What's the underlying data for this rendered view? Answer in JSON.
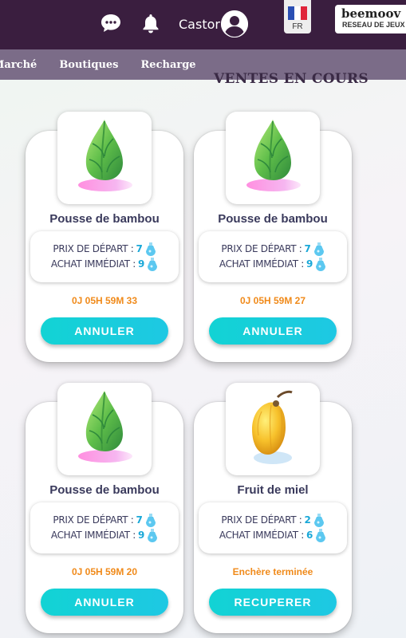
{
  "header": {
    "username": "Castor",
    "language": "FR",
    "brand_name": "beemoov",
    "brand_sub": "RESEAU DE JEUX",
    "icons": [
      "chat-icon",
      "bell-icon",
      "user-avatar-icon",
      "french-flag-icon"
    ]
  },
  "nav": {
    "items": [
      "Marché",
      "Boutiques",
      "Recharge"
    ]
  },
  "section_title": "VENTES EN COURS",
  "colors": {
    "topbar": "#3a1e3f",
    "nav": "#7b6c88",
    "price_value": "#1aa8d8",
    "timer": "#f08a1a",
    "button": "#14cfd9"
  },
  "cards": [
    {
      "name": "Pousse de bambou",
      "start_label": "PRIX DE DÉPART :",
      "start_price": "7",
      "buy_label": "ACHAT IMMÉDIAT :",
      "buy_price": "9",
      "timer": "0J 05H 59M 33",
      "button": "ANNULER",
      "image": "bamboo-shoot"
    },
    {
      "name": "Pousse de bambou",
      "start_label": "PRIX DE DÉPART :",
      "start_price": "7",
      "buy_label": "ACHAT IMMÉDIAT :",
      "buy_price": "9",
      "timer": "0J 05H 59M 27",
      "button": "ANNULER",
      "image": "bamboo-shoot"
    },
    {
      "name": "Pousse de bambou",
      "start_label": "PRIX DE DÉPART :",
      "start_price": "7",
      "buy_label": "ACHAT IMMÉDIAT :",
      "buy_price": "9",
      "timer": "0J 05H 59M 20",
      "button": "ANNULER",
      "image": "bamboo-shoot"
    },
    {
      "name": "Fruit de miel",
      "start_label": "PRIX DE DÉPART :",
      "start_price": "2",
      "buy_label": "ACHAT IMMÉDIAT :",
      "buy_price": "6",
      "timer": "Enchère terminée",
      "button": "RECUPERER",
      "image": "honey-fruit"
    }
  ]
}
